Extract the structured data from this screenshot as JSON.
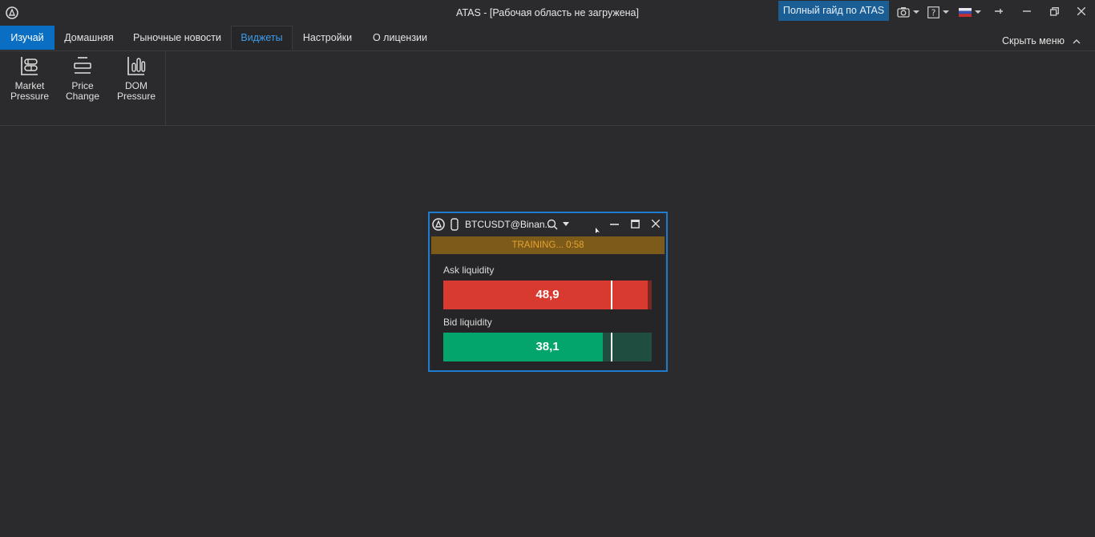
{
  "window": {
    "title": "ATAS - [Рабочая область не загружена]",
    "guide_button": "Полный гайд по ATAS"
  },
  "menu": {
    "tabs": [
      {
        "label": "Изучай"
      },
      {
        "label": "Домашняя"
      },
      {
        "label": "Рыночные новости"
      },
      {
        "label": "Виджеты"
      },
      {
        "label": "Настройки"
      },
      {
        "label": "О лицензии"
      }
    ],
    "active_tab": "Виджеты",
    "hide_menu": "Скрыть меню"
  },
  "ribbon": {
    "buttons": [
      {
        "label": "Market\nPressure",
        "icon": "market-pressure-icon"
      },
      {
        "label": "Price\nChange",
        "icon": "price-change-icon"
      },
      {
        "label": "DOM\nPressure",
        "icon": "dom-pressure-icon"
      }
    ]
  },
  "widget": {
    "symbol": "BTCUSDT@Binan...",
    "status": "TRAINING... 0:58",
    "ask": {
      "label": "Ask liquidity",
      "value": "48,9",
      "fill_fraction": 0.98,
      "marker_fraction": 0.805,
      "color": "#d93a2f",
      "track_color": "#7a2620"
    },
    "bid": {
      "label": "Bid liquidity",
      "value": "38,1",
      "fill_fraction": 0.765,
      "marker_fraction": 0.805,
      "color": "#04a46d",
      "track_color": "#1f4d3f"
    }
  },
  "colors": {
    "background": "#2b2b2d",
    "accent": "#0a6fc2",
    "widget_border": "#1e7bd0",
    "training_bg": "#7c5a1a",
    "training_text": "#e8a330"
  }
}
